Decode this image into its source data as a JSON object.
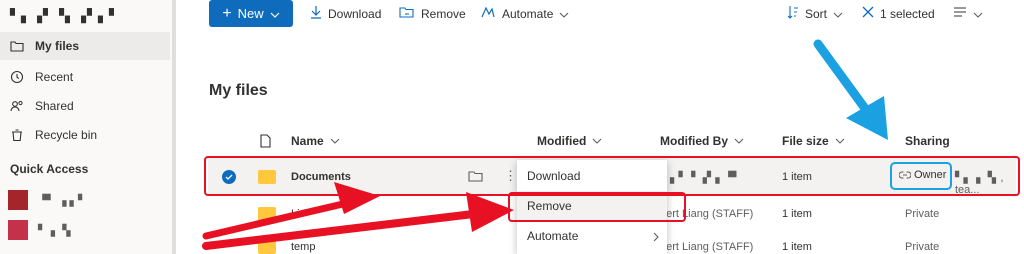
{
  "sidebar": {
    "user": "▘▖▗▘▝▖▗▘▖▘",
    "items": [
      {
        "label": "My files",
        "icon": "folder-icon",
        "active": true
      },
      {
        "label": "Recent",
        "icon": "history-icon"
      },
      {
        "label": "Shared",
        "icon": "people-icon"
      },
      {
        "label": "Recycle bin",
        "icon": "trash-icon"
      }
    ],
    "quick_access_title": "Quick Access",
    "quick_access": [
      {
        "label": "▝▘ ▗ ▖▘"
      },
      {
        "label": "▘▗ ▝▖"
      }
    ]
  },
  "toolbar": {
    "new_label": "New",
    "download_label": "Download",
    "remove_label": "Remove",
    "automate_label": "Automate",
    "sort_label": "Sort",
    "selected_label": "1 selected"
  },
  "page_title": "My files",
  "columns": {
    "name": "Name",
    "modified": "Modified",
    "modified_by": "Modified By",
    "file_size": "File size",
    "sharing": "Sharing"
  },
  "rows": [
    {
      "name": "Documents",
      "modified_by": "▖▘▝ ▗▘▖▝▘",
      "size": "1 item",
      "sharing": "Owner",
      "sharing_extra": "▘▖▗ ▝▖, tea..."
    },
    {
      "name": "Li",
      "modified_by": "bert Liang (STAFF)",
      "size": "1 item",
      "sharing": "Private"
    },
    {
      "name": "temp",
      "modified_by": "bert Liang (STAFF)",
      "size": "1 item",
      "sharing": "Private"
    }
  ],
  "context_menu": {
    "items": [
      "Download",
      "Remove",
      "Automate"
    ]
  },
  "colors": {
    "accent": "#0f6cbd",
    "annotation_red": "#e81123",
    "annotation_blue": "#1ba1e2",
    "folder": "#ffc83d"
  }
}
